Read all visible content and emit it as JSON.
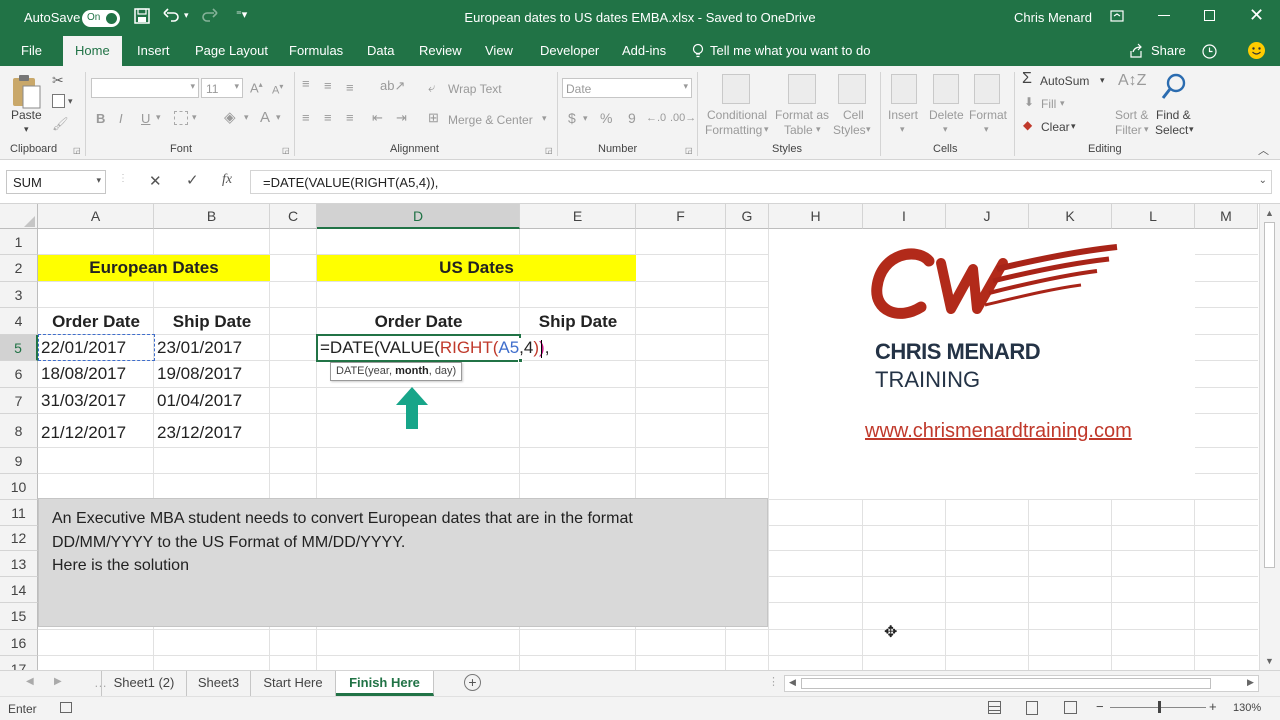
{
  "titlebar": {
    "autosave_label": "AutoSave",
    "autosave_state": "On",
    "title": "European dates to US dates EMBA.xlsx  -  Saved to OneDrive",
    "user": "Chris Menard"
  },
  "tabs": [
    "File",
    "Home",
    "Insert",
    "Page Layout",
    "Formulas",
    "Data",
    "Review",
    "View",
    "Developer",
    "Add-ins"
  ],
  "tell_me": "Tell me what you want to do",
  "share_label": "Share",
  "ribbon": {
    "clipboard": {
      "paste": "Paste",
      "label": "Clipboard"
    },
    "font": {
      "size": "11",
      "bold": "B",
      "italic": "I",
      "underline": "U",
      "label": "Font"
    },
    "alignment": {
      "wrap_text": "Wrap Text",
      "merge_center": "Merge & Center",
      "label": "Alignment"
    },
    "number": {
      "format": "Date",
      "currency": "$",
      "percent": "%",
      "comma": "9",
      "label": "Number"
    },
    "styles": {
      "conditional": "Conditional",
      "formatting": "Formatting",
      "format_as": "Format as",
      "table": "Table",
      "cell": "Cell",
      "cell_styles": "Styles",
      "label": "Styles"
    },
    "cells": {
      "insert": "Insert",
      "delete": "Delete",
      "format": "Format",
      "label": "Cells"
    },
    "editing": {
      "autosum": "AutoSum",
      "fill": "Fill",
      "clear": "Clear",
      "sort": "Sort &",
      "filter": "Filter",
      "find": "Find &",
      "select": "Select",
      "label": "Editing"
    }
  },
  "formula_bar": {
    "name_box": "SUM",
    "fx": "fx",
    "formula": "=DATE(VALUE(RIGHT(A5,4)),"
  },
  "columns": [
    "A",
    "B",
    "C",
    "D",
    "E",
    "F",
    "G",
    "H",
    "I",
    "J",
    "K",
    "L",
    "M"
  ],
  "rows": [
    "1",
    "2",
    "3",
    "4",
    "5",
    "6",
    "7",
    "8",
    "9",
    "10",
    "11",
    "12",
    "13",
    "14",
    "15",
    "16",
    "17"
  ],
  "sheet": {
    "european_header": "European Dates",
    "us_header": "US Dates",
    "order_date": "Order Date",
    "ship_date": "Ship Date",
    "us_order_date": "Order Date",
    "us_ship_date": "Ship Date",
    "european_dates": [
      {
        "order": "22/01/2017",
        "ship": "23/01/2017"
      },
      {
        "order": "18/08/2017",
        "ship": "19/08/2017"
      },
      {
        "order": "31/03/2017",
        "ship": "01/04/2017"
      },
      {
        "order": "21/12/2017",
        "ship": "23/12/2017"
      }
    ],
    "editing_formula": {
      "p1": "=DATE(VALUE(",
      "p2": "RIGHT(",
      "p3": "A5",
      "p4": ",4",
      "p5": ")",
      "p6": ")",
      "p7": ","
    },
    "tooltip": {
      "pre": "DATE(year, ",
      "bold": "month",
      "post": ", day)"
    },
    "note_line1": "An Executive MBA student needs to convert European dates that are in the format",
    "note_line2": "DD/MM/YYYY to the US Format of MM/DD/YYYY.",
    "note_line3": "Here is the solution"
  },
  "logo": {
    "brand": "CHRIS MENARD",
    "sub": "TRAINING",
    "url": "www.chrismenardtraining.com"
  },
  "sheet_tabs": [
    "Sheet1 (2)",
    "Sheet3",
    "Start Here",
    "Finish Here"
  ],
  "active_sheet": "Finish Here",
  "status": {
    "mode": "Enter",
    "zoom": "130%"
  },
  "colors": {
    "excel_green": "#217346",
    "yellow": "#ffff00",
    "note_gray": "#d9d9d9",
    "logo_red": "#b22a1a",
    "teal": "#17a589"
  }
}
